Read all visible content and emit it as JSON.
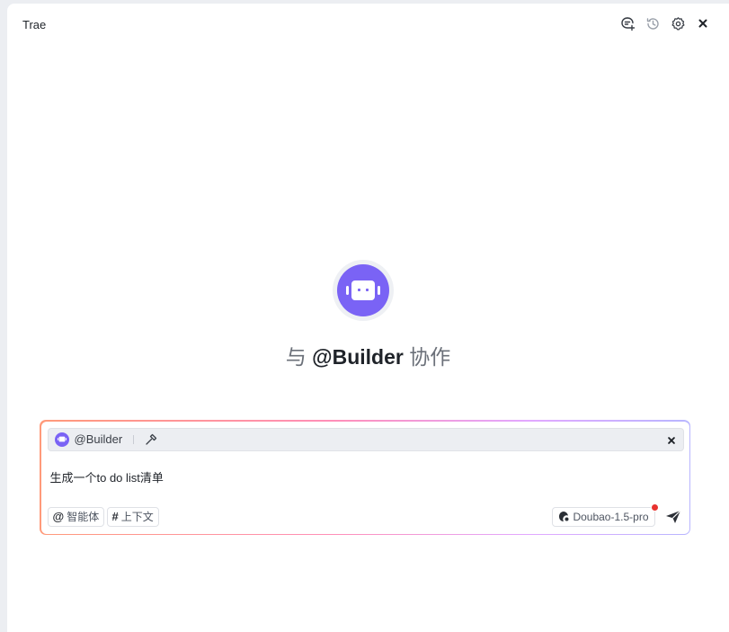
{
  "window": {
    "title": "Trae"
  },
  "toolbar": {
    "icons": [
      "new-chat-icon",
      "history-icon",
      "settings-icon",
      "close-icon"
    ]
  },
  "hero": {
    "prefix": "与",
    "agent": "@Builder",
    "suffix": "协作"
  },
  "composer": {
    "agent_chip": {
      "name": "@Builder"
    },
    "input_value": "生成一个to do list清单",
    "agent_button": {
      "symbol": "@",
      "label": "智能体"
    },
    "context_button": {
      "symbol": "#",
      "label": "上下文"
    },
    "model": {
      "label": "Doubao-1.5-pro"
    }
  },
  "colors": {
    "accent": "#7a63f5",
    "notification_dot": "#e8322f",
    "border_gradient": [
      "#ff9a7a",
      "#ff8fb8",
      "#e2a8ff",
      "#b8b6ff"
    ]
  }
}
